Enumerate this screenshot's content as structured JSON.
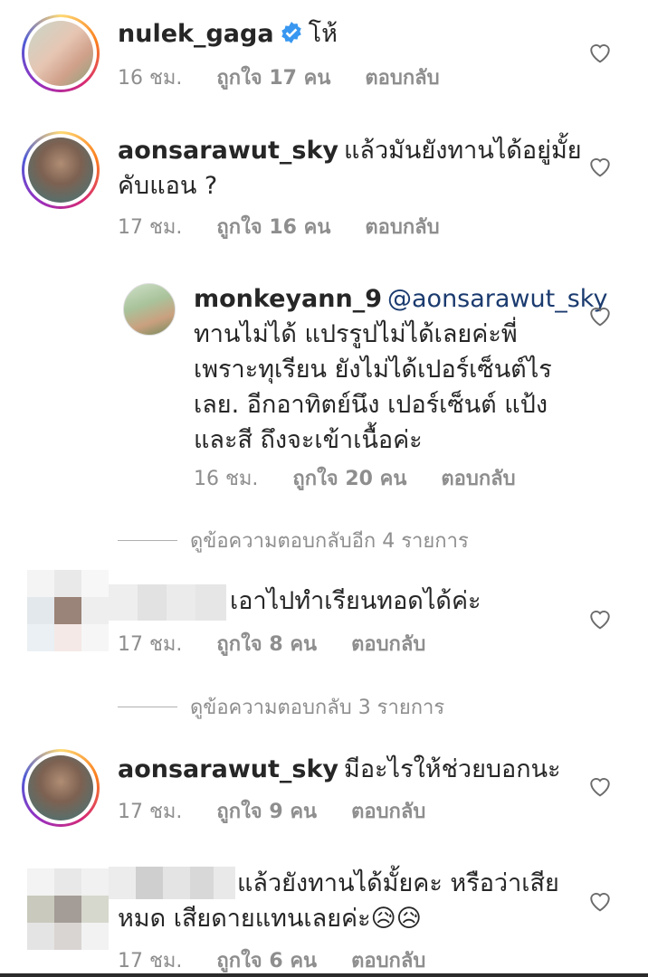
{
  "comments": [
    {
      "username": "nulek_gaga",
      "verified": true,
      "text": "โห้",
      "time": "16 ชม.",
      "likes": "ถูกใจ 17 คน",
      "reply": "ตอบกลับ",
      "avatar": "story-ring-avatar"
    },
    {
      "username": "aonsarawut_sky",
      "text_line1": "แล้วมันยังทานได้อยู่มั้ย",
      "text_line2": "คับแอน ?",
      "time": "17 ชม.",
      "likes": "ถูกใจ 16 คน",
      "reply": "ตอบกลับ"
    },
    {
      "username": "monkeyann_9",
      "mention": "@aonsarawut_sky",
      "text_line1": "ทานไม่ได้ แปรรูปไม่ได้เลยค่ะพี่",
      "text_line2": "เพราะทุเรียน ยังไม่ได้เปอร์เซ็นต์ไร",
      "text_line3": "เลย. อีกอาทิตย์นึง เปอร์เซ็นต์ แป้ง",
      "text_line4": "และสี ถึงจะเข้าเนื้อค่ะ",
      "time": "16 ชม.",
      "likes": "ถูกใจ 20 คน",
      "reply": "ตอบกลับ"
    },
    {
      "view_replies": "ดูข้อความตอบกลับอีก 4 รายการ"
    },
    {
      "text": "เอาไปทำเรียนทอดได้ค่ะ",
      "time": "17 ชม.",
      "likes": "ถูกใจ 8 คน",
      "reply": "ตอบกลับ"
    },
    {
      "view_replies": "ดูข้อความตอบกลับ 3 รายการ"
    },
    {
      "username": "aonsarawut_sky",
      "text": "มีอะไรให้ช่วยบอกนะ",
      "time": "17 ชม.",
      "likes": "ถูกใจ 9 คน",
      "reply": "ตอบกลับ"
    },
    {
      "text_line1": "แล้วยังทานได้มั้ยคะ หรือว่าเสีย",
      "text_line2": "หมด เสียดายแทนเลยค่ะ😥😥",
      "time": "17 ชม.",
      "likes": "ถูกใจ 6 คน",
      "reply": "ตอบกลับ"
    }
  ],
  "colors": {
    "text": "#262626",
    "meta": "#8e8e8e",
    "verified": "#3897f0",
    "mention": "#1b3b6f"
  }
}
